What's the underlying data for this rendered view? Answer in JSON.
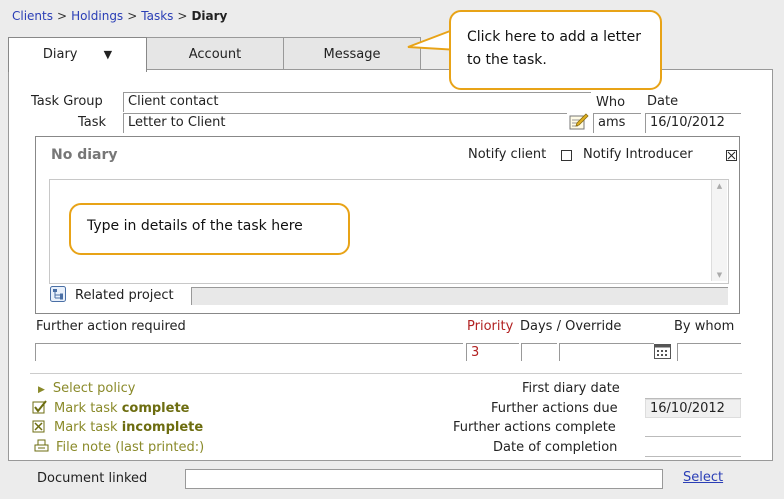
{
  "breadcrumb": {
    "items": [
      "Clients",
      "Holdings",
      "Tasks"
    ],
    "current": "Diary",
    "separator": ">"
  },
  "tabs": [
    {
      "label": "Diary",
      "active": true
    },
    {
      "label": "Account",
      "active": false
    },
    {
      "label": "Message",
      "active": false
    }
  ],
  "callouts": {
    "message_tab": "Click here to add a letter to the task.",
    "diary_text": "Type in details of the task here"
  },
  "form": {
    "task_group_label": "Task Group",
    "task_group_value": "Client contact",
    "task_label": "Task",
    "task_value": "Letter to Client",
    "who_label": "Who",
    "who_value": "ams",
    "date_label": "Date",
    "date_value": "16/10/2012"
  },
  "diary": {
    "title": "No diary",
    "notify_client_label": "Notify client",
    "notify_client_checked": false,
    "notify_introducer_label": "Notify Introducer",
    "notify_introducer_checked": true,
    "related_project_label": "Related project",
    "related_project_value": ""
  },
  "further": {
    "label": "Further action required",
    "priority_label": "Priority",
    "days_override_label": "Days / Override",
    "by_whom_label": "By whom",
    "priority_value": "3"
  },
  "actions": {
    "select_policy": "Select policy",
    "mark_complete_prefix": "Mark task ",
    "mark_complete_bold": "complete",
    "mark_incomplete_prefix": "Mark task ",
    "mark_incomplete_bold": "incomplete",
    "file_note": "File note (last printed:)"
  },
  "summary": {
    "first_diary_date_label": "First diary date",
    "first_diary_date_value": "",
    "further_actions_due_label": "Further actions due",
    "further_actions_due_value": "16/10/2012",
    "further_actions_complete_label": "Further actions complete",
    "further_actions_complete_value": "",
    "date_of_completion_label": "Date of completion",
    "date_of_completion_value": ""
  },
  "document": {
    "label": "Document linked",
    "value": "",
    "select_link": "Select"
  },
  "colors": {
    "link": "#2a3eb6",
    "callout_border": "#e8a317",
    "priority": "#b22222",
    "olive": "#8a8a2a"
  }
}
